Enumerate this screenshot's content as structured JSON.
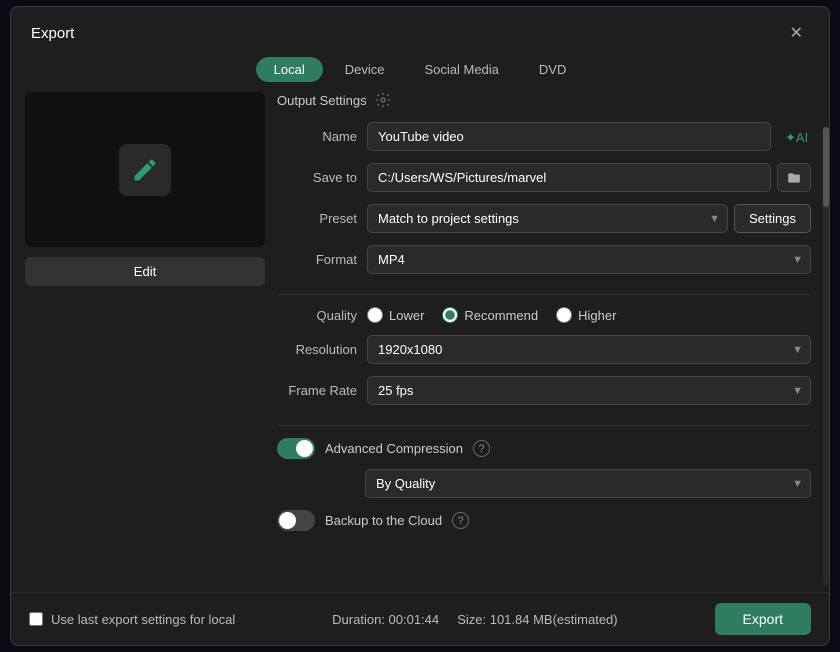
{
  "modal": {
    "title": "Export",
    "close_label": "✕"
  },
  "tabs": [
    {
      "id": "local",
      "label": "Local",
      "active": true
    },
    {
      "id": "device",
      "label": "Device",
      "active": false
    },
    {
      "id": "social-media",
      "label": "Social Media",
      "active": false
    },
    {
      "id": "dvd",
      "label": "DVD",
      "active": false
    }
  ],
  "output_settings": {
    "header": "Output Settings"
  },
  "form": {
    "name_label": "Name",
    "name_value": "YouTube video",
    "save_to_label": "Save to",
    "save_to_value": "C:/Users/WS/Pictures/marvel",
    "preset_label": "Preset",
    "preset_value": "Match to project settings",
    "settings_btn": "Settings",
    "format_label": "Format",
    "format_value": "MP4",
    "quality_label": "Quality",
    "quality_lower": "Lower",
    "quality_recommend": "Recommend",
    "quality_higher": "Higher",
    "resolution_label": "Resolution",
    "resolution_value": "1920x1080",
    "frame_rate_label": "Frame Rate",
    "frame_rate_value": "25 fps"
  },
  "advanced": {
    "compression_label": "Advanced Compression",
    "compression_sub_value": "By Quality",
    "backup_label": "Backup to the Cloud"
  },
  "footer": {
    "checkbox_label": "Use last export settings for local",
    "duration_label": "Duration: 00:01:44",
    "size_label": "Size: 101.84 MB(estimated)",
    "export_btn": "Export"
  },
  "edit_btn": "Edit"
}
